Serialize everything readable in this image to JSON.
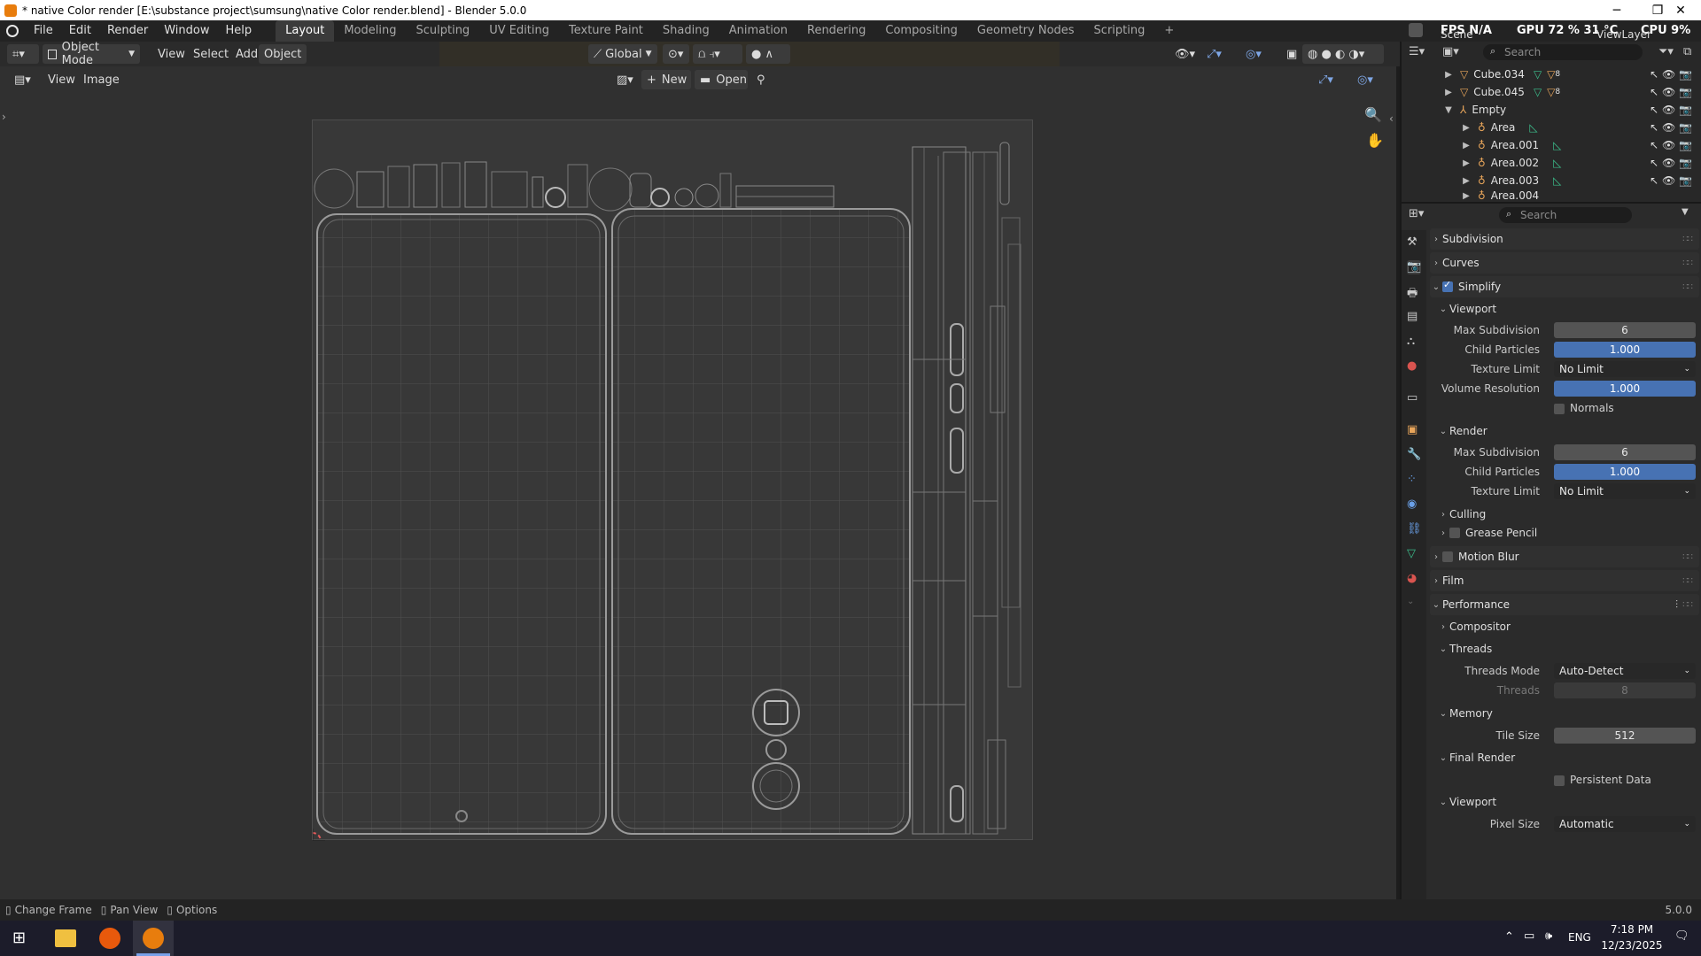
{
  "window": {
    "title": "* native Color render [E:\\substance project\\sumsung\\native Color render.blend] - Blender 5.0.0",
    "minimize": "─",
    "maximize": "❐",
    "close": "✕"
  },
  "menus": [
    "File",
    "Edit",
    "Render",
    "Window",
    "Help"
  ],
  "workspaces": [
    "Layout",
    "Modeling",
    "Sculpting",
    "UV Editing",
    "Texture Paint",
    "Shading",
    "Animation",
    "Rendering",
    "Compositing",
    "Geometry Nodes",
    "Scripting"
  ],
  "workspace_add": "+",
  "overlay_stats": {
    "fps": "FPS  N/A",
    "gpu": "GPU  72 %  31 °C",
    "cpu": "CPU  9%"
  },
  "scene": {
    "label": "Scene",
    "view_layer": "ViewLayer"
  },
  "viewport_header": {
    "mode": "Object Mode",
    "menus": [
      "View",
      "Select",
      "Add",
      "Object"
    ],
    "transform_orientation": "Global"
  },
  "image_editor_header": {
    "menus": [
      "View",
      "Image"
    ],
    "new_label": "New",
    "open_label": "Open"
  },
  "outliner": {
    "search_placeholder": "Search",
    "rows": [
      {
        "name": "Cube.034",
        "badge": "8"
      },
      {
        "name": "Cube.045",
        "badge": "8"
      },
      {
        "name": "Empty",
        "badge": ""
      },
      {
        "name": "Area",
        "badge": ""
      },
      {
        "name": "Area.001",
        "badge": ""
      },
      {
        "name": "Area.002",
        "badge": ""
      },
      {
        "name": "Area.003",
        "badge": ""
      },
      {
        "name": "Area.004",
        "badge": ""
      }
    ]
  },
  "properties": {
    "search_placeholder": "Search",
    "subdivision": "Subdivision",
    "curves": "Curves",
    "simplify": "Simplify",
    "viewport": "Viewport",
    "max_subdivision_label": "Max Subdivision",
    "max_subdivision_viewport": "6",
    "child_particles_label": "Child Particles",
    "child_particles_viewport": "1.000",
    "texture_limit_label": "Texture Limit",
    "texture_limit_viewport": "No Limit",
    "volume_resolution_label": "Volume Resolution",
    "volume_resolution": "1.000",
    "normals": "Normals",
    "render": "Render",
    "max_subdivision_render": "6",
    "child_particles_render": "1.000",
    "texture_limit_render": "No Limit",
    "culling": "Culling",
    "grease_pencil": "Grease Pencil",
    "motion_blur": "Motion Blur",
    "film": "Film",
    "performance": "Performance",
    "compositor": "Compositor",
    "threads": "Threads",
    "threads_mode_label": "Threads Mode",
    "threads_mode": "Auto-Detect",
    "threads_label": "Threads",
    "threads_value": "8",
    "memory": "Memory",
    "tile_size_label": "Tile Size",
    "tile_size": "512",
    "final_render": "Final Render",
    "persistent_data": "Persistent Data",
    "viewport2": "Viewport",
    "pixel_size_label": "Pixel Size",
    "pixel_size": "Automatic"
  },
  "statusbar": {
    "change_frame": "Change Frame",
    "pan_view": "Pan View",
    "options": "Options",
    "version": "5.0.0"
  },
  "taskbar": {
    "language": "ENG",
    "time": "7:18 PM",
    "date": "12/23/2025"
  },
  "colors": {
    "accent_blue": "#4772b3",
    "blender_orange": "#e87d0d",
    "header_bg": "#2b2b2b",
    "panel_bg": "#303030"
  }
}
